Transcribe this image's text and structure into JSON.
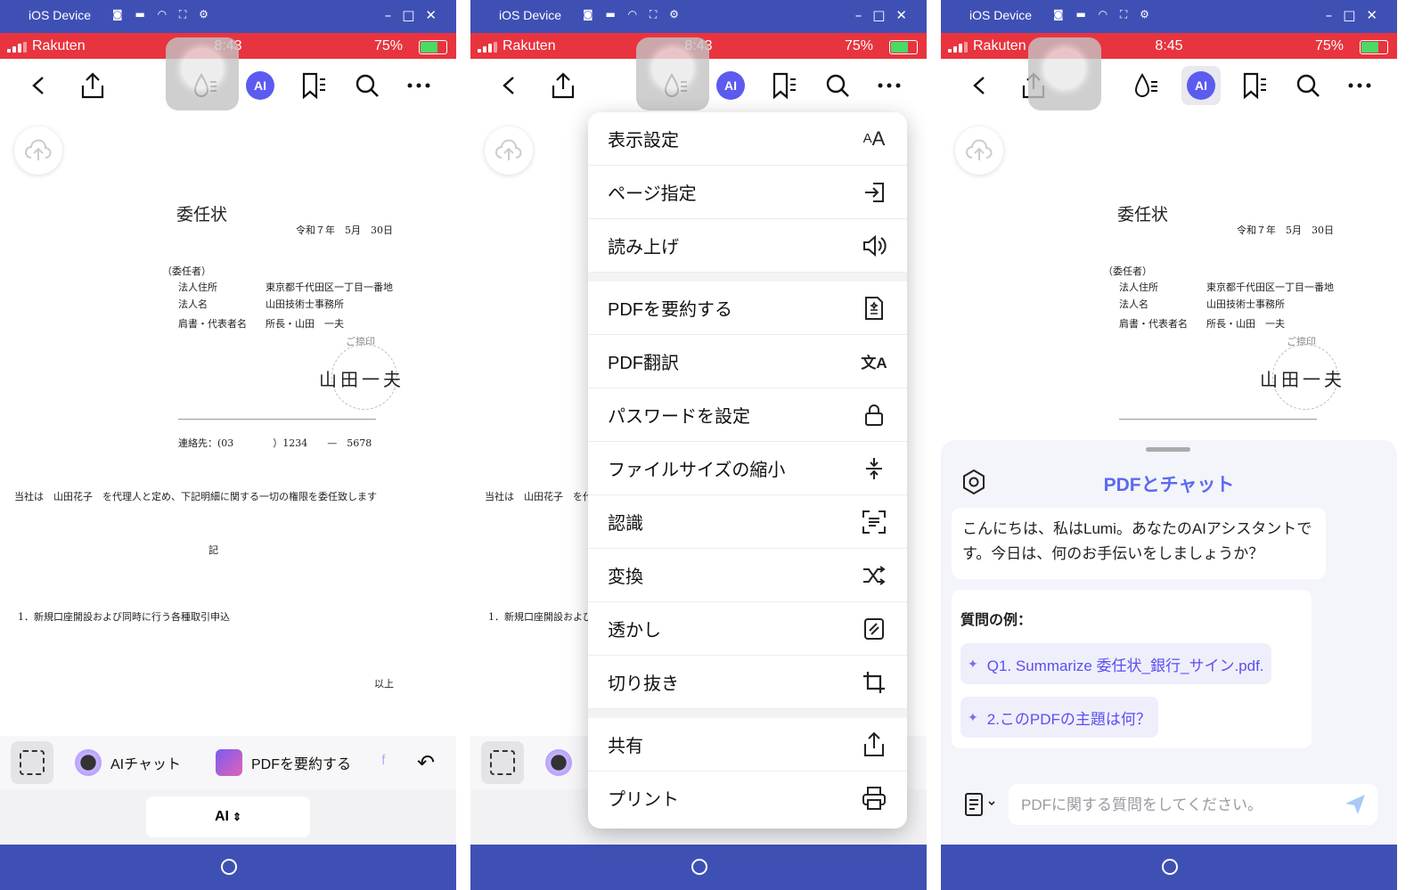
{
  "window": {
    "title": "iOS Device",
    "controls": [
      "–",
      "□",
      "✕"
    ]
  },
  "status": {
    "carrier": "Rakuten",
    "battery": "75%",
    "time_1": "8:43",
    "time_2": "8:43",
    "time_3": "8:45"
  },
  "colors": {
    "titlebar": "#3f50b5",
    "statusbar": "#e8343f",
    "accent": "#5b5bf0"
  },
  "document": {
    "title": "委任状",
    "date": "令和７年　5月　30日",
    "delegator_label": "（委任者）",
    "address_label": "法人住所",
    "address_value": "東京都千代田区一丁目一番地",
    "name_label": "法人名",
    "name_value": "山田技術士事務所",
    "rep_label": "肩書・代表者名",
    "rep_value": "所長・山田　一夫",
    "seal_label": "ご捺印",
    "signature": "山田一夫",
    "contact": "連絡先：(03　　　　）1234　　—　5678",
    "body": "当社は　山田花子　を代理人と定め、下記明細に関する一切の権限を委任致します",
    "ki": "記",
    "item1": "1．新規口座開設および同時に行う各種取引申込",
    "ijou": "以上"
  },
  "bottom": {
    "ai_chat": "AIチャット",
    "summarize": "PDFを要約する",
    "mode": "AI"
  },
  "menu": {
    "items": [
      {
        "label": "表示設定",
        "icon": "AA"
      },
      {
        "label": "ページ指定",
        "icon": "⇥"
      },
      {
        "label": "読み上げ",
        "icon": "🔊"
      },
      {
        "label": "PDFを要約する",
        "icon": "▤"
      },
      {
        "label": "PDF翻訳",
        "icon": "文A"
      },
      {
        "label": "パスワードを設定",
        "icon": "🔒"
      },
      {
        "label": "ファイルサイズの縮小",
        "icon": "⇳"
      },
      {
        "label": "認識",
        "icon": "[≡]"
      },
      {
        "label": "変換",
        "icon": "⤨"
      },
      {
        "label": "透かし",
        "icon": "▧"
      },
      {
        "label": "切り抜き",
        "icon": "⌗"
      },
      {
        "label": "共有",
        "icon": "⇪"
      },
      {
        "label": "プリント",
        "icon": "⎙"
      }
    ]
  },
  "chat": {
    "title": "PDFとチャット",
    "greeting": "こんにちは、私はLumi。あなたのAIアシスタントです。今日は、何のお手伝いをしましょうか？",
    "examples_label": "質問の例：",
    "q1": "Q1. Summarize 委任状_銀行_サイン.pdf.",
    "q2": "2.このPDFの主題は何？",
    "placeholder": "PDFに関する質問をしてください。"
  }
}
